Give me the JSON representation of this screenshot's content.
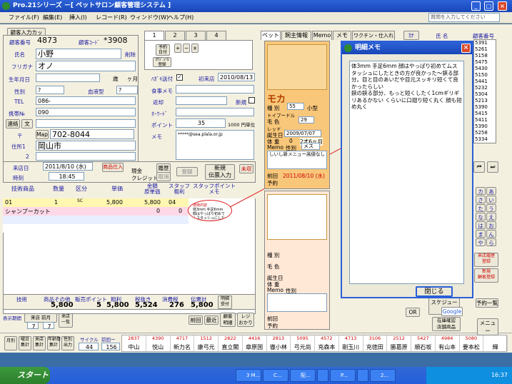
{
  "window": {
    "title": "Pro.21シリーズ  －[ ペットサロン顧客管理システム ]"
  },
  "menu": {
    "items": [
      "ファイル(F)",
      "編集(E)",
      "挿入(I)",
      "レコード(R)",
      "ウィンドウ(W)",
      "ヘルプ(H)"
    ],
    "help_placeholder": "質問を入力してください"
  },
  "customer": {
    "new_button": "顧客入力カッタ",
    "number_label": "顧客番号",
    "number": "4873",
    "code_label": "顧客ｺｰﾄﾞ",
    "code": "*3908",
    "name_label": "氏名",
    "name": "小野",
    "delete_label": "削除",
    "kana_label": "フリガナ",
    "kana": "オノ",
    "birthday_label": "生年月日",
    "age_unit": "歳",
    "month_unit": "ヶ月",
    "gender_label": "性別",
    "gender": "?",
    "blood_label": "血液型",
    "blood": "?",
    "tel_label": "TEL",
    "tel": "086-",
    "mobile_label": "携帯№",
    "mobile": "090",
    "contact_btn": "連絡",
    "mail_btn": "文",
    "zip_label": "〒",
    "map_btn": "Map",
    "zip": "702-8044",
    "address1_label": "住所1",
    "address1": "岡山市",
    "address2_label": "2",
    "dm_label": "ﾊｶﾞｷ送付",
    "first_label": "初来店",
    "first_date": "2010/08/13",
    "meal_label": "食事メモ",
    "return_label": "返却",
    "new_label": "新規",
    "keyword_label": "ｵｰﾜｰﾄﾞ",
    "point_label": "ポイント",
    "points": "35",
    "point_unit": "1000 円単位",
    "memo_label": "メモ",
    "memo_value": "*****@sea.plala.or.jp"
  },
  "tabs": {
    "pages": [
      "1",
      "2",
      "3",
      "4"
    ],
    "reserve_btn": "予約\n日付",
    "schedule_btn": "ｽｹｼﾞｭｰﾙ\n登録"
  },
  "visit": {
    "date_label": "来店日",
    "date": "2011/8/10 (水)",
    "time_label": "時刻",
    "time": "18:45",
    "goods_btn": "商品仕入",
    "cash_label": "現金",
    "credit_label": "クレジット",
    "history_btn": "履歴",
    "history_sub": "取消",
    "register_btn": "登録",
    "new_slip_btn": "新規\n伝票入力",
    "unfinished_btn": "未収"
  },
  "slip_table": {
    "headers": [
      "技術商品",
      "数量",
      "区分",
      "単価",
      "金額\n原単価",
      "スタッフ\n粗利",
      "スタッフポイント\nメモ"
    ],
    "rows": [
      {
        "code": "01",
        "qty": "1",
        "kind": "SC",
        "price": "5,800",
        "amount": "5,800",
        "staff": "04",
        "memo": ""
      },
      {
        "code": "シャンプーカット",
        "qty": "",
        "kind": "",
        "price": "",
        "amount": "0",
        "staff": "0",
        "memo": ""
      }
    ],
    "tooltip_title": "技術内容",
    "tooltip": "体3mm 手足6mm 顔はやっぱり初めてムスタッシュにしたときの方が良かった⋯"
  },
  "totals": {
    "labels": [
      "技術",
      "商品その他",
      "販売ポイント",
      "粗利",
      "税抜き",
      "消費税",
      "伝票計",
      "明細\n受付"
    ],
    "values": [
      "5,800",
      "",
      "5",
      "5,800",
      "5,524",
      "276",
      "5,800"
    ]
  },
  "bottom_buttons": {
    "show_label": "表示期間",
    "today_btn": "来店 前月",
    "all_btn": "来店 前月",
    "period_label": "来店\n一覧",
    "week": "7",
    "month": "7",
    "prev_btn": "前回",
    "latest_btn": "最近",
    "detail_btn": "顧客\n明細",
    "receipt_btn": "レジ\nおかり"
  },
  "footer_buttons": [
    "月別",
    "曜日\n集計",
    "来店\n集計",
    "年齢層\n集計",
    "性別\n出力"
  ],
  "cycle": {
    "label": "サイクル",
    "days": "44",
    "interval_label": "前回ー",
    "interval": "156"
  },
  "staff": [
    {
      "code": "2837",
      "name": "中山"
    },
    {
      "code": "4390",
      "name": "悦山"
    },
    {
      "code": "4717",
      "name": "新力名"
    },
    {
      "code": "1512",
      "name": "康弓元"
    },
    {
      "code": "2822",
      "name": "直立閣"
    },
    {
      "code": "4416",
      "name": "章原国"
    },
    {
      "code": "2813",
      "name": "徹小林"
    },
    {
      "code": "5095",
      "name": "弓元尚"
    },
    {
      "code": "4572",
      "name": "充森本"
    },
    {
      "code": "4713",
      "name": "剛玉川"
    },
    {
      "code": "3106",
      "name": "充徳田"
    },
    {
      "code": "2512",
      "name": "勝葛原"
    },
    {
      "code": "5427",
      "name": "順石坂"
    },
    {
      "code": "4984",
      "name": "有山本"
    },
    {
      "code": "5080",
      "name": "要本松"
    },
    {
      "code": "",
      "name": "輝"
    }
  ],
  "pet_tabs": [
    "ペット",
    "飼主情報",
    "Memo",
    "メモ",
    "ワクチン・仕入れ"
  ],
  "pet1": {
    "name": "モカ",
    "type_label": "種 別",
    "type": "55",
    "size": "小型",
    "breed": "トイプードル",
    "color_label": "毛 色",
    "color": "29",
    "color_name": "レッド",
    "birthday_label": "誕生日",
    "birthday": "2009/07/07",
    "weight_label": "体 重",
    "weight": "0",
    "age": "2才6ヶ月",
    "memo_label": "Memo",
    "gender_label": "性別",
    "gender": "メス",
    "memo": "しいし新メニュー高値なし",
    "last_label": "前回",
    "last": "2011/08/10 (水)",
    "reserve_label": "予約"
  },
  "pet2": {
    "type_label": "種 別",
    "color_label": "毛 色",
    "birthday_label": "誕生日",
    "weight_label": "体 重",
    "memo_label": "Memo",
    "gender_label": "性別",
    "last_label": "前回",
    "reserve_label": "予約"
  },
  "memo_dialog": {
    "title": "明細メモ",
    "text": "体3mm 手足6mm 顔はやっぱり初めてムスタッシュにしたときの方が良かった～鋏る部分。目と目のあいだや目元スッキリ短くて良かったらしい\n鋏の鋏る部分、もっと短くしたく1cmギリギリあるかない くらいに口廻り短く丸く 顔も短め丸く",
    "close_btn": "閉じる"
  },
  "right_panel": {
    "header": "顧客番号",
    "name_header": "氏 名",
    "numbers": [
      "5391",
      "5261",
      "5158",
      "5475",
      "5430",
      "5150",
      "5441",
      "5232",
      "5304",
      "5213",
      "5390",
      "5415",
      "5411",
      "5390",
      "5258",
      "5334"
    ],
    "kana_rows": [
      [
        "カ",
        "あ"
      ],
      [
        "さ",
        "い"
      ],
      [
        "た",
        "う"
      ],
      [
        "な",
        "え"
      ],
      [
        "は",
        "お"
      ],
      [
        "ま",
        "ん"
      ],
      [
        "や",
        "ら"
      ]
    ],
    "buttons": [
      "来店履歴\n登録",
      "新規\n顧客登録",
      "スケジュール",
      "予約一覧",
      "OR",
      "Google",
      "在庫確認\n店舗商品",
      "メニュー"
    ]
  },
  "taskbar": {
    "start": "スタート",
    "tasks": [
      "3 M...",
      "C...",
      "配...",
      "",
      "P...",
      "",
      "2..."
    ],
    "clock": "16:37"
  }
}
